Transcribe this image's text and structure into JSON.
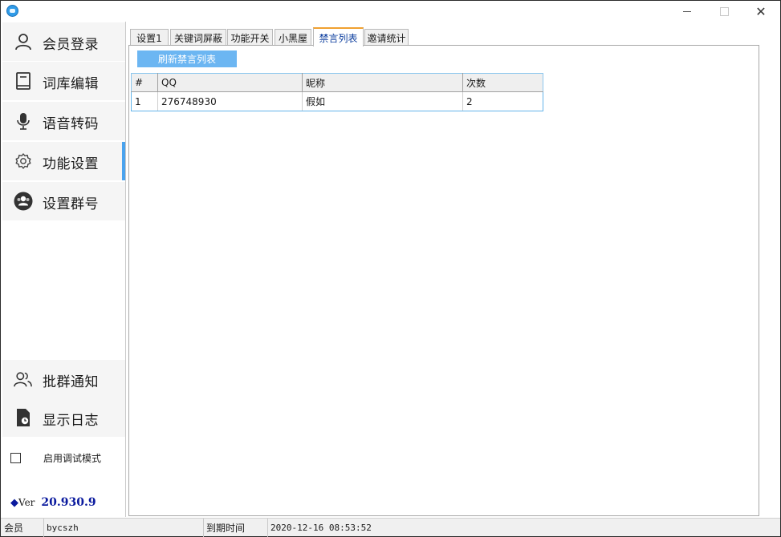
{
  "window": {
    "close_glyph": "✕"
  },
  "sidebar": {
    "items": [
      {
        "label": "会员登录",
        "icon": "user-icon"
      },
      {
        "label": "词库编辑",
        "icon": "book-icon"
      },
      {
        "label": "语音转码",
        "icon": "microphone-icon"
      },
      {
        "label": "功能设置",
        "icon": "gear-icon"
      },
      {
        "label": "设置群号",
        "icon": "group-icon"
      },
      {
        "label": "批群通知",
        "icon": "users-icon"
      },
      {
        "label": "显示日志",
        "icon": "log-file-icon"
      }
    ],
    "active_index": 3,
    "debug_mode_label": "启用调试模式",
    "debug_mode_checked": false,
    "version": {
      "diamond": "◆",
      "prefix": "Ver",
      "number": "20.930.9"
    }
  },
  "tabs": [
    {
      "label": "设置1"
    },
    {
      "label": "关键词屏蔽"
    },
    {
      "label": "功能开关"
    },
    {
      "label": "小黑屋"
    },
    {
      "label": "禁言列表"
    },
    {
      "label": "邀请统计"
    }
  ],
  "active_tab": 4,
  "mute_list": {
    "refresh_label": "刷新禁言列表",
    "columns": [
      "#",
      "QQ",
      "昵称",
      "次数"
    ],
    "rows": [
      [
        "1",
        "276748930",
        "假如",
        "2"
      ]
    ]
  },
  "statusbar": {
    "member_label": "会员",
    "member_value": "bycszh",
    "expiry_label": "到期时间",
    "expiry_value": "2020-12-16 08:53:52"
  },
  "colors": {
    "accent": "#4aa3ee",
    "button": "#6cb6f2",
    "active_tab_text": "#0b3d9e",
    "version_blue": "#0a1a9e"
  }
}
